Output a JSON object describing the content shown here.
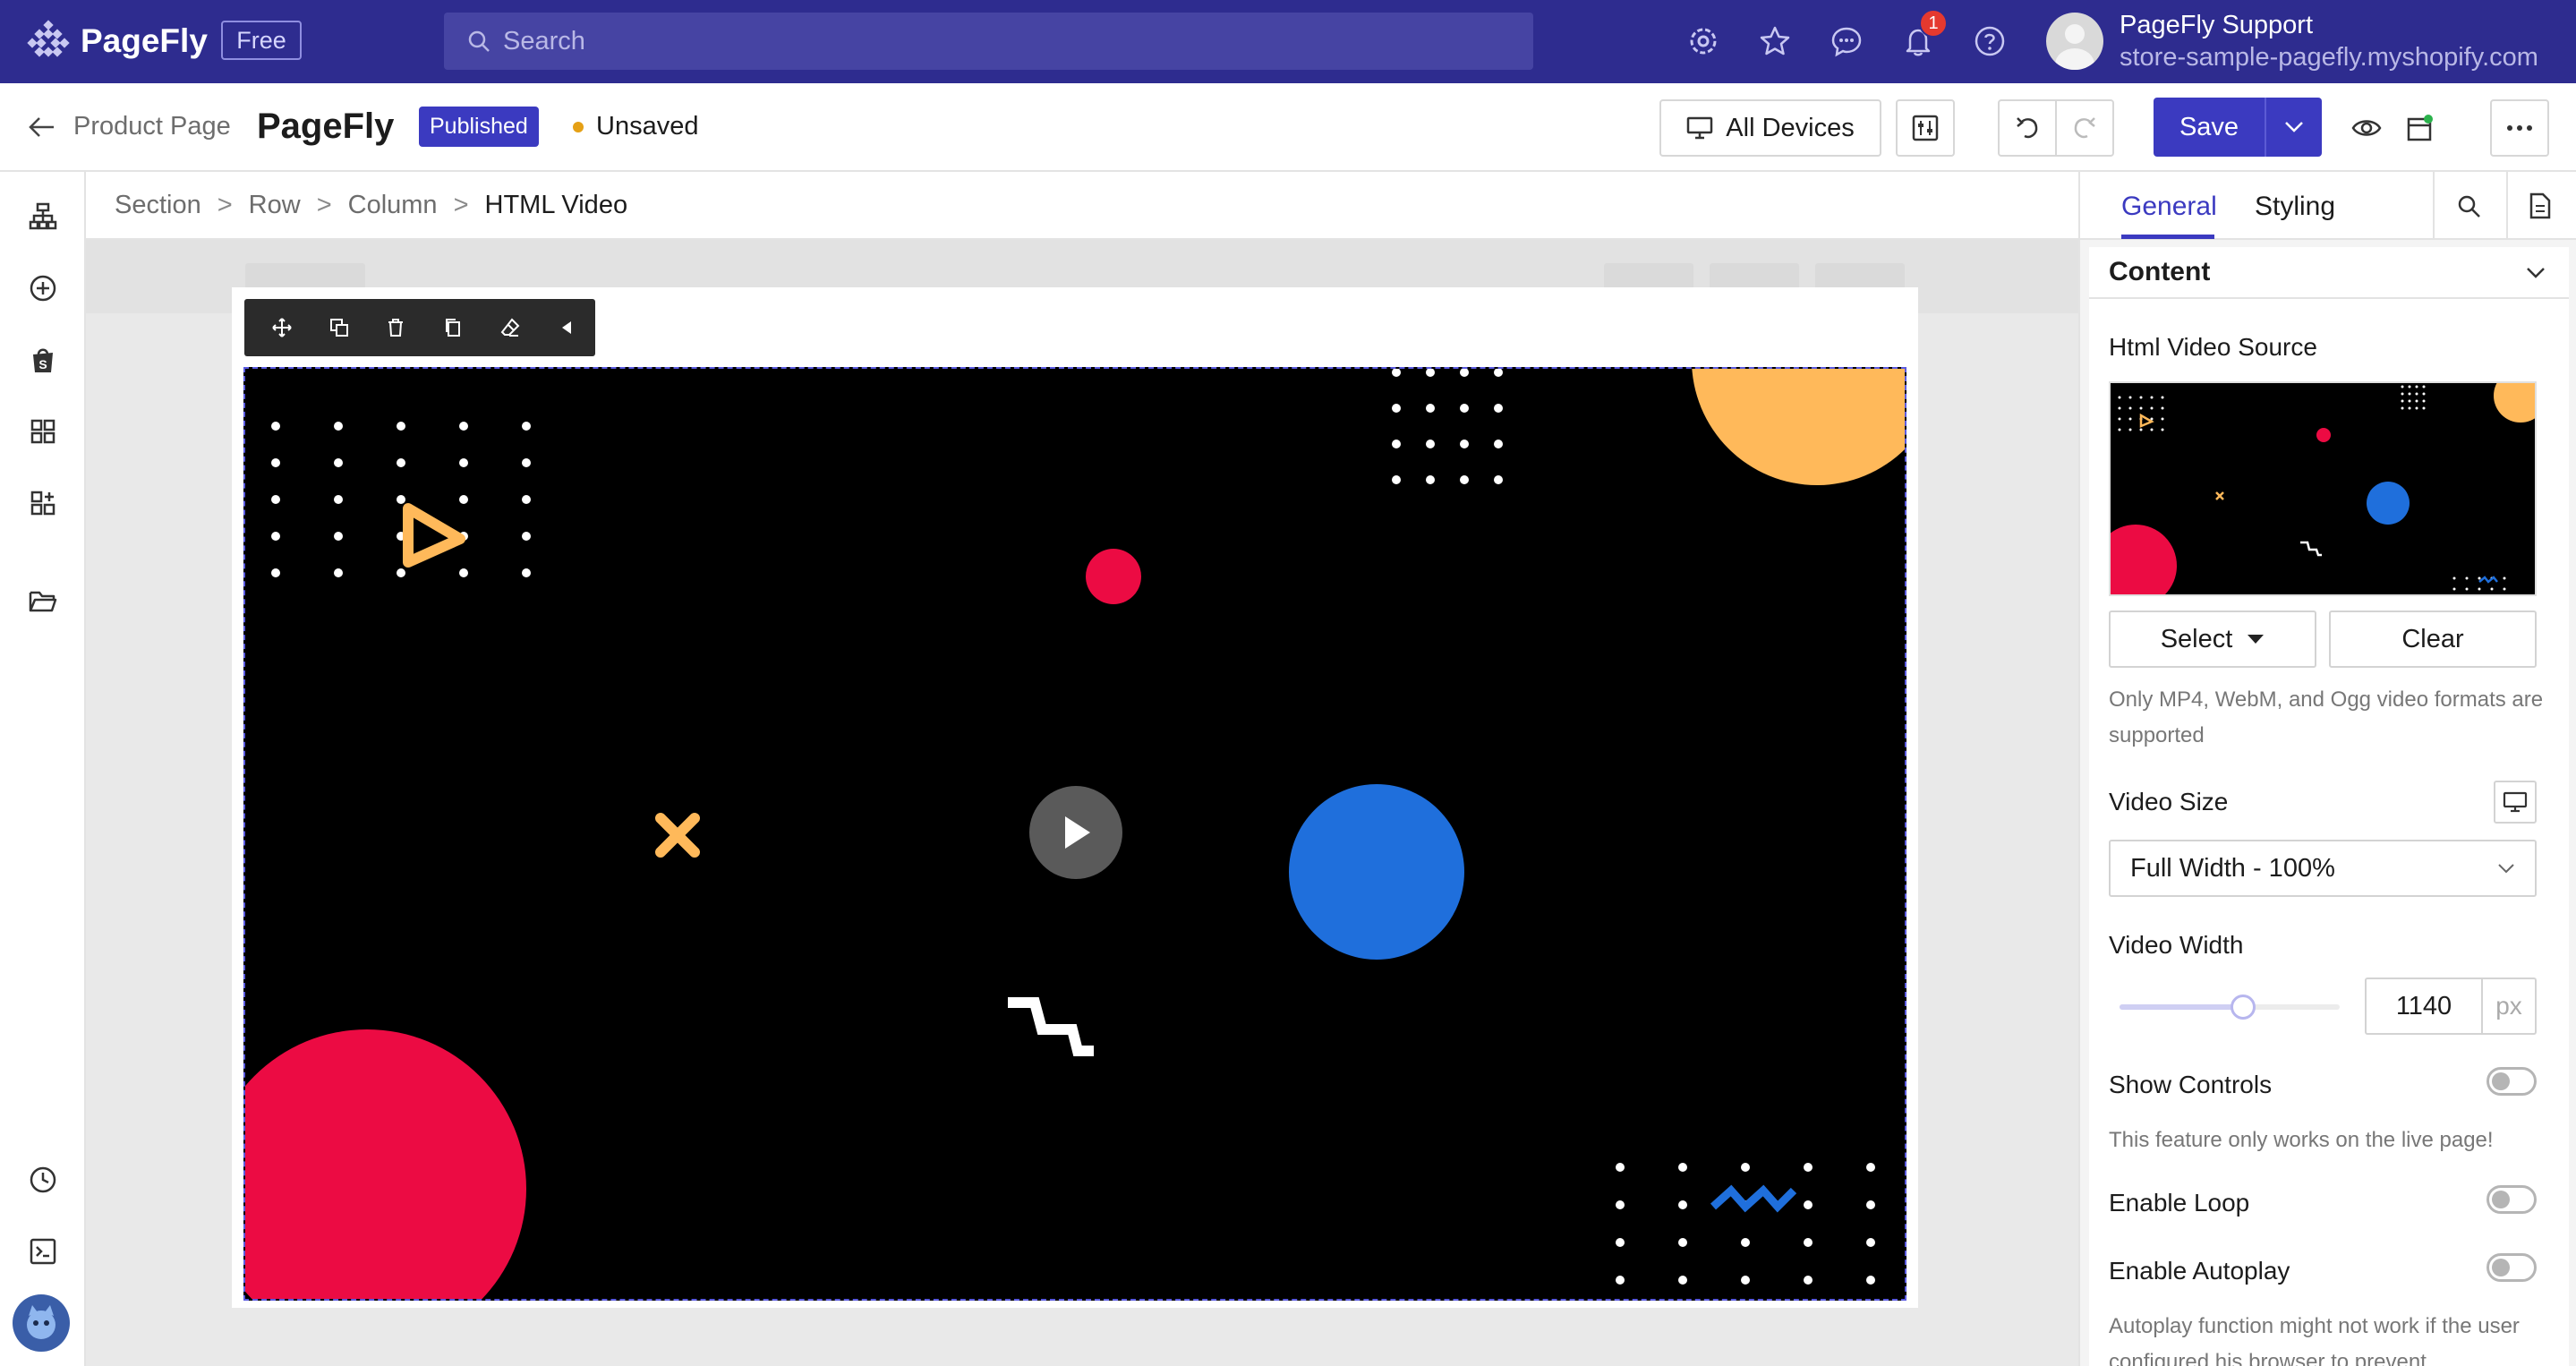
{
  "topbar": {
    "logo_text": "PageFly",
    "plan_badge": "Free",
    "search_placeholder": "Search",
    "notification_count": "1",
    "user_name": "PageFly Support",
    "user_store": "store-sample-pagefly.myshopify.com"
  },
  "header": {
    "back_label": "Product Page",
    "page_title": "PageFly",
    "status_badge": "Published",
    "save_state": "Unsaved",
    "devices_label": "All Devices",
    "save_label": "Save"
  },
  "breadcrumb": {
    "items": [
      "Section",
      "Row",
      "Column",
      "HTML Video"
    ],
    "separator": ">"
  },
  "right_panel": {
    "tabs": [
      "General",
      "Styling"
    ],
    "active_tab": "General",
    "section_title": "Content",
    "video_source_label": "Html Video Source",
    "select_button": "Select",
    "clear_button": "Clear",
    "format_help": "Only MP4, WebM, and Ogg video formats are supported",
    "video_size_label": "Video Size",
    "video_size_value": "Full Width - 100%",
    "video_width_label": "Video Width",
    "video_width_value": "1140",
    "video_width_unit": "px",
    "video_width_slider_fraction": 0.56,
    "show_controls_label": "Show Controls",
    "show_controls_on": false,
    "show_controls_help": "This feature only works on the live page!",
    "enable_loop_label": "Enable Loop",
    "enable_loop_on": false,
    "enable_autoplay_label": "Enable Autoplay",
    "enable_autoplay_on": false,
    "autoplay_help": "Autoplay function might not work if the user configured his browser to prevent"
  },
  "colors": {
    "brand": "#2e2c8f",
    "accent": "#3b3ac0",
    "video_red": "#ec0b43",
    "video_orange": "#ffb95a",
    "video_blue": "#1f6fdc"
  }
}
